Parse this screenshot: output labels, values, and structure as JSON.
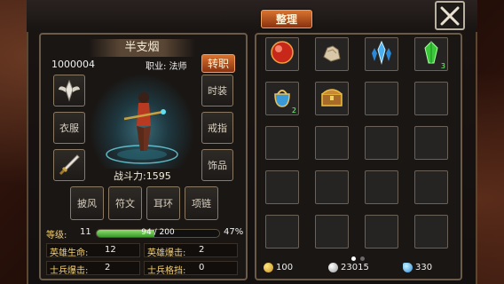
{
  "header": {
    "sort_label": "整理"
  },
  "character": {
    "name": "半支烟",
    "id": "1000004",
    "job": "职业: 法师",
    "job_change_label": "转职",
    "power_label": "战斗力:1595"
  },
  "equip_slots": {
    "clothes": "衣服",
    "fashion": "时装",
    "ring": "戒指",
    "ornament": "饰品",
    "cloak": "披风",
    "rune": "符文",
    "earring": "耳环",
    "necklace": "项链"
  },
  "level": {
    "label": "等级:",
    "value": "11",
    "xp_text": "94 / 200",
    "xp_fraction": 0.47,
    "percent": "47%"
  },
  "stats": {
    "hero_hp_label": "英雄生命:",
    "hero_hp_value": "12",
    "hero_crit_label": "英雄爆击:",
    "hero_crit_value": "2",
    "soldier_crit_label": "士兵爆击:",
    "soldier_crit_value": "2",
    "soldier_block_label": "士兵格挡:",
    "soldier_block_value": "0"
  },
  "inventory": {
    "items": [
      {
        "icon": "red-orb-icon",
        "count": ""
      },
      {
        "icon": "ore-icon",
        "count": ""
      },
      {
        "icon": "blue-crystal-icon",
        "count": ""
      },
      {
        "icon": "green-gem-icon",
        "count": "3"
      },
      {
        "icon": "blue-bag-icon",
        "count": "2"
      },
      {
        "icon": "treasure-chest-icon",
        "count": ""
      }
    ],
    "page_dots": 2,
    "active_page": 0
  },
  "currency": {
    "gold": "100",
    "silver": "23015",
    "diamond": "330"
  },
  "colors": {
    "accent": "#c8581e",
    "gold_text": "#f4d070",
    "xp_bar": "#5cc040"
  }
}
